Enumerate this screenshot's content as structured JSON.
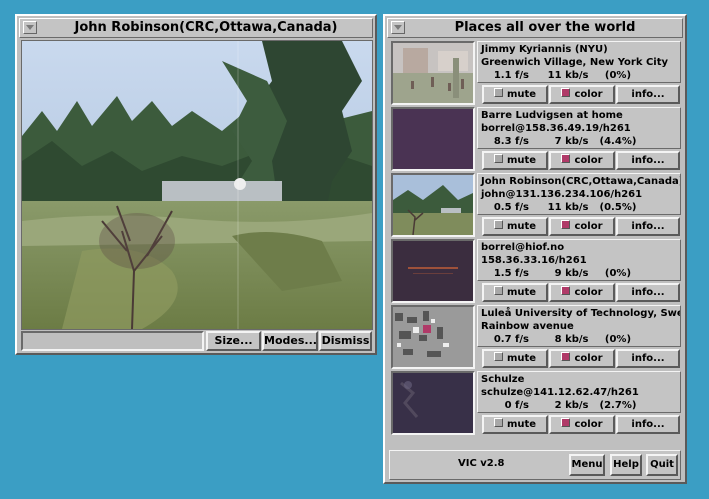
{
  "colors": {
    "desktop": "#3b9ec4",
    "chrome": "#bfbfbf",
    "indicator_off": "#a8a8a8",
    "indicator_on": "#b03a68"
  },
  "main_window": {
    "title": "John Robinson(CRC,Ottawa,Canada)",
    "menu_icon": "window-menu-icon",
    "status_text": "",
    "buttons": {
      "size": "Size...",
      "modes": "Modes...",
      "dismiss": "Dismiss"
    }
  },
  "list_window": {
    "title": "Places all over the world",
    "menu_icon": "window-menu-icon",
    "entries": [
      {
        "name": "Jimmy Kyriannis (NYU)",
        "address": "Greenwich Village, New York City",
        "fps": "1.1 f/s",
        "kbps": "11 kb/s",
        "loss": "(0%)",
        "mute": "mute",
        "color": "color",
        "info": "info...",
        "mute_on": false,
        "color_on": true
      },
      {
        "name": "Barre Ludvigsen at home",
        "address": "borrel@158.36.49.19/h261",
        "fps": "8.3 f/s",
        "kbps": "7 kb/s",
        "loss": "(4.4%)",
        "mute": "mute",
        "color": "color",
        "info": "info...",
        "mute_on": false,
        "color_on": true
      },
      {
        "name": "John Robinson(CRC,Ottawa,Canada)",
        "address": "john@131.136.234.106/h261",
        "fps": "0.5 f/s",
        "kbps": "11 kb/s",
        "loss": "(0.5%)",
        "mute": "mute",
        "color": "color",
        "info": "info...",
        "mute_on": false,
        "color_on": true
      },
      {
        "name": "borrel@hiof.no",
        "address": "158.36.33.16/h261",
        "fps": "1.5 f/s",
        "kbps": "9 kb/s",
        "loss": "(0%)",
        "mute": "mute",
        "color": "color",
        "info": "info...",
        "mute_on": false,
        "color_on": true
      },
      {
        "name": "Luleå University of Technology, Sweden",
        "address": "Rainbow avenue",
        "fps": "0.7 f/s",
        "kbps": "8 kb/s",
        "loss": "(0%)",
        "mute": "mute",
        "color": "color",
        "info": "info...",
        "mute_on": false,
        "color_on": true
      },
      {
        "name": "Schulze",
        "address": "schulze@141.12.62.47/h261",
        "fps": "0 f/s",
        "kbps": "2 kb/s",
        "loss": "(2.7%)",
        "mute": "mute",
        "color": "color",
        "info": "info...",
        "mute_on": false,
        "color_on": true
      }
    ],
    "footer": {
      "version": "VIC v2.8",
      "menu": "Menu",
      "help": "Help",
      "quit": "Quit"
    }
  }
}
